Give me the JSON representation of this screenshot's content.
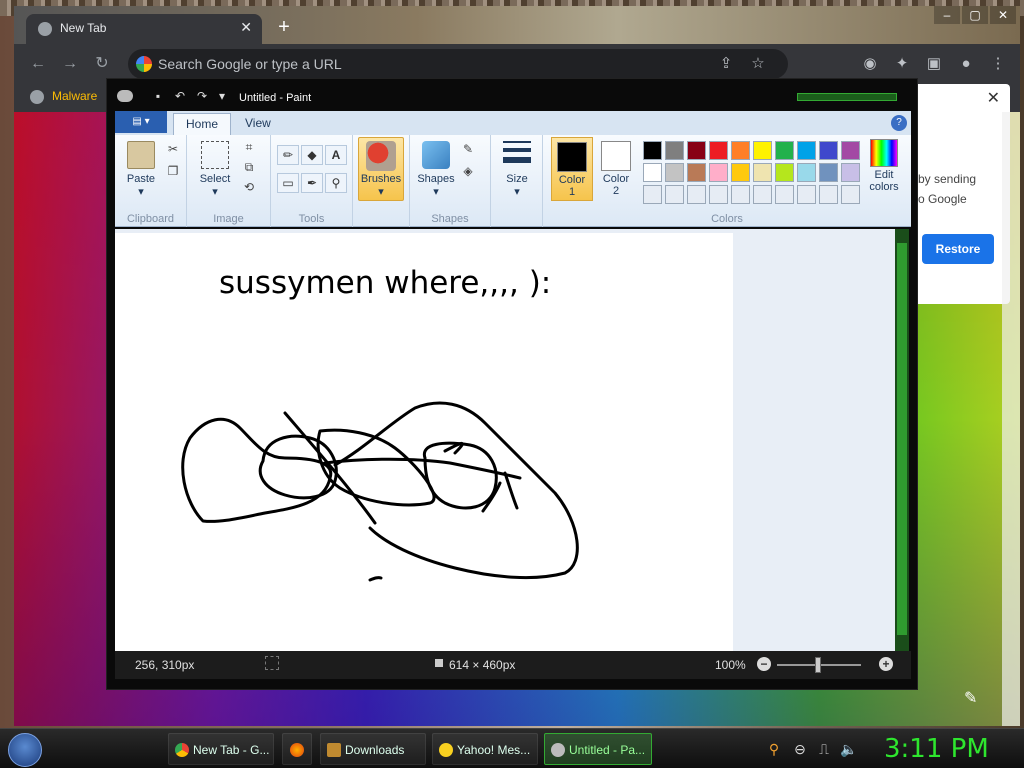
{
  "chrome": {
    "tab_title": "New Tab",
    "omnibox_placeholder": "Search Google or type a URL",
    "bookmark": "Malware",
    "notification": {
      "line1": "by sending",
      "line2": "o Google",
      "restore": "Restore"
    }
  },
  "paint": {
    "window_title": "Untitled - Paint",
    "tabs": [
      "Home",
      "View"
    ],
    "groups": {
      "clipboard": {
        "label": "Clipboard",
        "paste": "Paste"
      },
      "image": {
        "label": "Image",
        "select": "Select"
      },
      "tools": {
        "label": "Tools"
      },
      "brushes": "Brushes",
      "shapes": {
        "label": "Shapes",
        "shapes_btn": "Shapes"
      },
      "size": "Size",
      "colors": {
        "label": "Colors",
        "color1": "Color\n1",
        "color2": "Color\n2",
        "edit": "Edit\ncolors"
      }
    },
    "palette": [
      [
        "#000000",
        "#7f7f7f",
        "#880015",
        "#ed1c24",
        "#ff7f27",
        "#fff200",
        "#22b14c",
        "#00a2e8",
        "#3f48cc",
        "#a349a4"
      ],
      [
        "#ffffff",
        "#c3c3c3",
        "#b97a57",
        "#ffaec9",
        "#ffc90e",
        "#efe4b0",
        "#b5e61d",
        "#99d9ea",
        "#7092be",
        "#c8bfe7"
      ],
      [
        "#e6ecf4",
        "#e6ecf4",
        "#e6ecf4",
        "#e6ecf4",
        "#e6ecf4",
        "#e6ecf4",
        "#e6ecf4",
        "#e6ecf4",
        "#e6ecf4",
        "#e6ecf4"
      ]
    ],
    "canvas_text": "sussymen where,,,, ):",
    "status": {
      "position": "256, 310px",
      "dimensions": "614 × 460px",
      "zoom": "100%"
    }
  },
  "taskbar": {
    "items": [
      "New Tab - G...",
      "",
      "Downloads",
      "Yahoo! Mes...",
      "Untitled - Pa..."
    ],
    "clock": "3:11 PM"
  },
  "colors": {
    "clock": "#2ee62e",
    "accent": "#1a73e8"
  }
}
